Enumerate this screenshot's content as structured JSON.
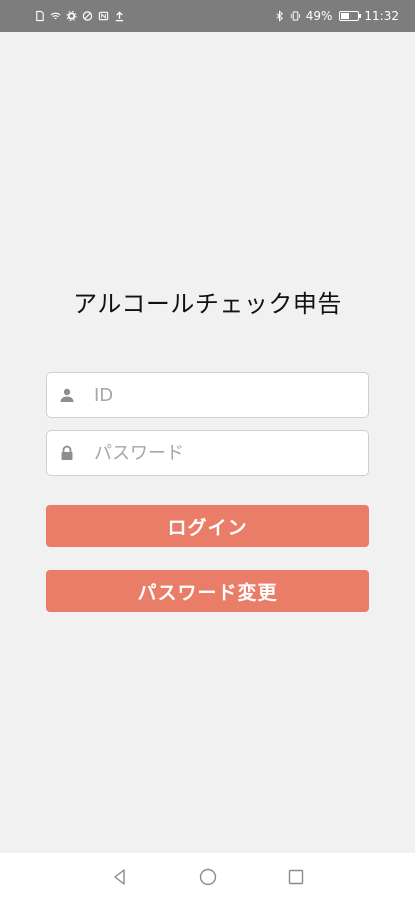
{
  "status_bar": {
    "battery_text": "49%",
    "battery_level": 0.49,
    "time": "11:32",
    "left_icons": [
      "sim-icon",
      "wifi-icon",
      "settings-icon",
      "vpn-icon",
      "nfc-icon",
      "upload-icon"
    ],
    "right_icons": [
      "bluetooth-icon",
      "vibrate-icon",
      "battery-icon"
    ]
  },
  "login": {
    "title": "アルコールチェック申告",
    "id_placeholder": "ID",
    "id_value": "",
    "password_placeholder": "パスワード",
    "password_value": "",
    "login_button": "ログイン",
    "change_password_button": "パスワード変更"
  },
  "nav_bar": {
    "buttons": [
      "back-icon",
      "home-icon",
      "recents-icon"
    ]
  },
  "colors": {
    "accent": "#e97d68",
    "status_bar": "#7d7d7d",
    "background": "#f1f1f1"
  }
}
